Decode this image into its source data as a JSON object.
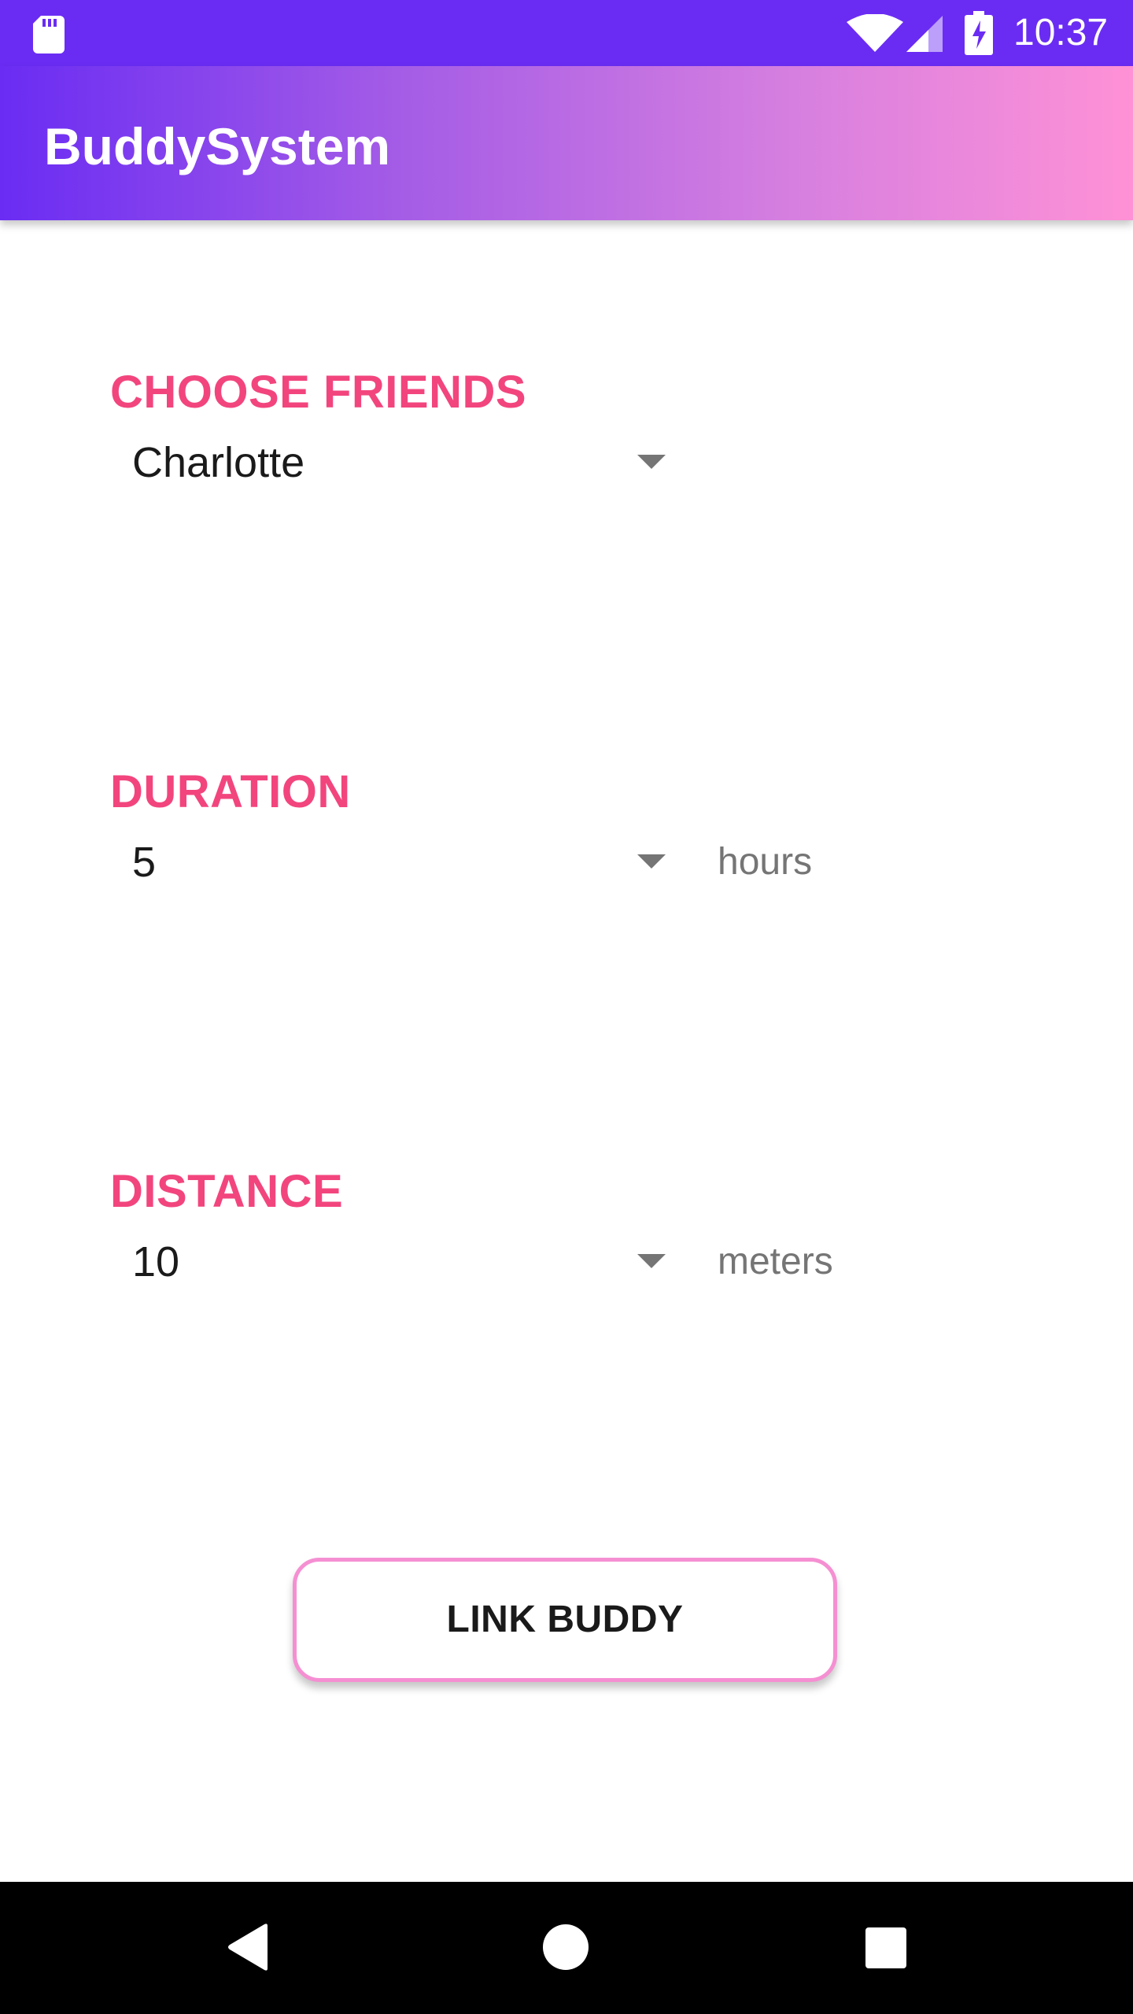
{
  "status_bar": {
    "time": "10:37",
    "icons": [
      "sd-card-icon",
      "wifi-icon",
      "cell-signal-icon",
      "battery-charging-icon"
    ]
  },
  "app_bar": {
    "title": "BuddySystem"
  },
  "friends": {
    "label": "CHOOSE FRIENDS",
    "selected": "Charlotte"
  },
  "duration": {
    "label": "DURATION",
    "selected": "5",
    "unit": "hours"
  },
  "distance": {
    "label": "DISTANCE",
    "selected": "10",
    "unit": "meters"
  },
  "link_button": {
    "label": "LINK BUDDY"
  },
  "colors": {
    "status_bar": "#6a2cf3",
    "app_bar_gradient_start": "#6a2cf3",
    "app_bar_gradient_end": "#ff91d6",
    "section_label": "#f2457e",
    "button_border": "#f58fd2",
    "nav_bar": "#000000"
  },
  "nav_bar": {
    "icons": [
      "back-icon",
      "home-icon",
      "recents-icon"
    ]
  }
}
